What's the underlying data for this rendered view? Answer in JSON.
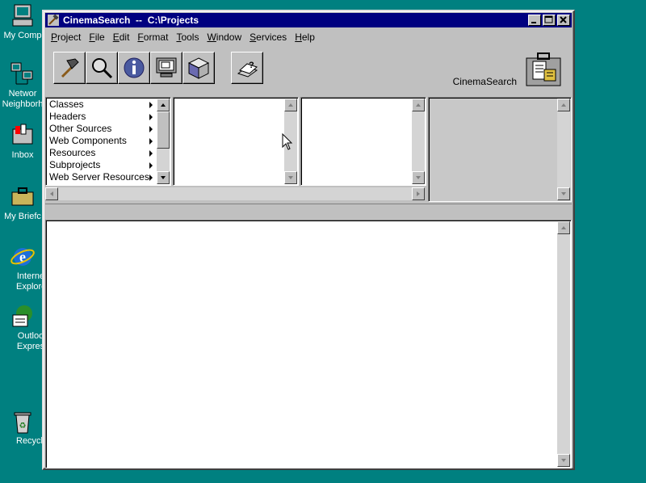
{
  "desktop": {
    "icons": [
      {
        "id": "my-computer",
        "label": "My Comp"
      },
      {
        "id": "network",
        "label": "Networ",
        "label2": "Neighborh"
      },
      {
        "id": "inbox",
        "label": "Inbox"
      },
      {
        "id": "briefcase",
        "label": "My Briefc"
      },
      {
        "id": "ie",
        "label": "Interne",
        "label2": "Explore"
      },
      {
        "id": "outlook",
        "label": "Outloo",
        "label2": "Expres"
      },
      {
        "id": "recycle",
        "label": "Recycle"
      }
    ]
  },
  "window": {
    "title": "CinemaSearch  --  C:\\Projects",
    "brand_label": "CinemaSearch",
    "accent_color": "#000080",
    "menu": [
      {
        "label": "Project",
        "u": "P",
        "rest": "roject"
      },
      {
        "label": "File",
        "u": "F",
        "rest": "ile"
      },
      {
        "label": "Edit",
        "u": "E",
        "rest": "dit"
      },
      {
        "label": "Format",
        "u": "F",
        "rest": "ormat"
      },
      {
        "label": "Tools",
        "u": "T",
        "rest": "ools"
      },
      {
        "label": "Window",
        "u": "W",
        "rest": "indow"
      },
      {
        "label": "Services",
        "u": "S",
        "rest": "ervices"
      },
      {
        "label": "Help",
        "u": "H",
        "rest": "elp"
      }
    ],
    "toolbar": [
      {
        "icon": "hammer-icon"
      },
      {
        "icon": "magnifier-icon"
      },
      {
        "icon": "info-icon"
      },
      {
        "icon": "monitor-icon"
      },
      {
        "icon": "cube-icon"
      },
      {
        "icon": "help-book-icon"
      }
    ]
  },
  "browser": {
    "categories": [
      "Classes",
      "Headers",
      "Other Sources",
      "Web Components",
      "Resources",
      "Subprojects",
      "Web Server Resources"
    ]
  }
}
